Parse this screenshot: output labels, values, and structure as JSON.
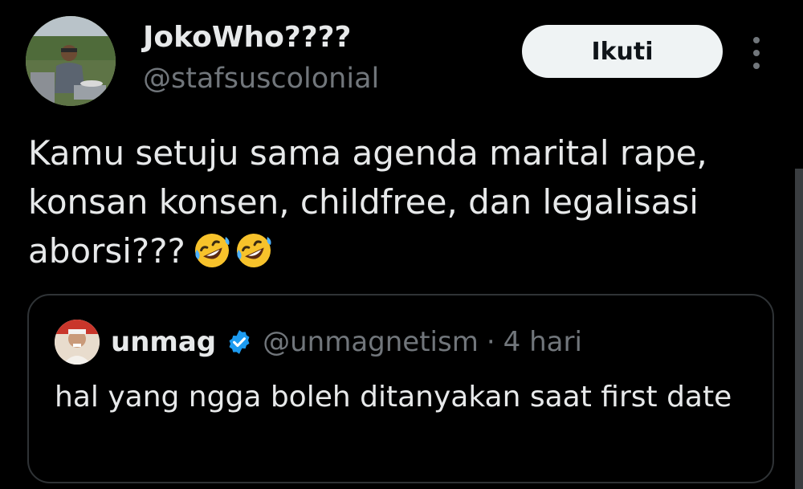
{
  "tweet": {
    "author": {
      "display_name": "JokoWho????",
      "handle": "@stafsuscolonial",
      "avatar_icon": "user-avatar-photo"
    },
    "follow_label": "Ikuti",
    "more_icon": "more-vertical-icon",
    "text": "Kamu setuju sama agenda marital rape,\nkonsan konsen, childfree, dan legalisasi\naborsi???",
    "emoji": [
      "rolling-on-the-floor-laughing-emoji",
      "rolling-on-the-floor-laughing-emoji"
    ]
  },
  "quoted_tweet": {
    "display_name": "unmag",
    "verified": true,
    "handle": "@unmagnetism",
    "separator": "·",
    "time": "4 hari",
    "text": "hal yang ngga boleh ditanyakan saat first date",
    "avatar_icon": "quoted-user-avatar"
  },
  "colors": {
    "background": "#000000",
    "text_primary": "#e7e9ea",
    "text_secondary": "#71767b",
    "follow_button_bg": "#eff3f4",
    "verified_blue": "#1d9bf0",
    "border": "#2f3336"
  }
}
